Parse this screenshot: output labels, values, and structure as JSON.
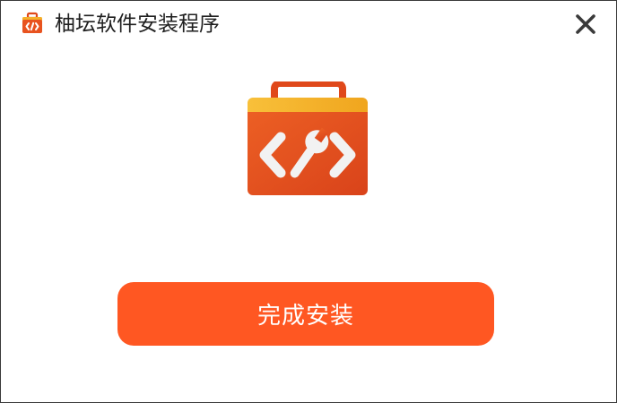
{
  "window": {
    "title": "柚坛软件安装程序",
    "app_icon": "toolbox-code-icon",
    "close_icon": "close-icon"
  },
  "main": {
    "hero_icon": "toolbox-wrench-code-icon",
    "finish_label": "完成安装"
  },
  "colors": {
    "accent": "#ff5722",
    "toolbox_top": "#f4b02a",
    "toolbox_body": "#e8531f",
    "toolbox_handle": "#e0481a"
  }
}
